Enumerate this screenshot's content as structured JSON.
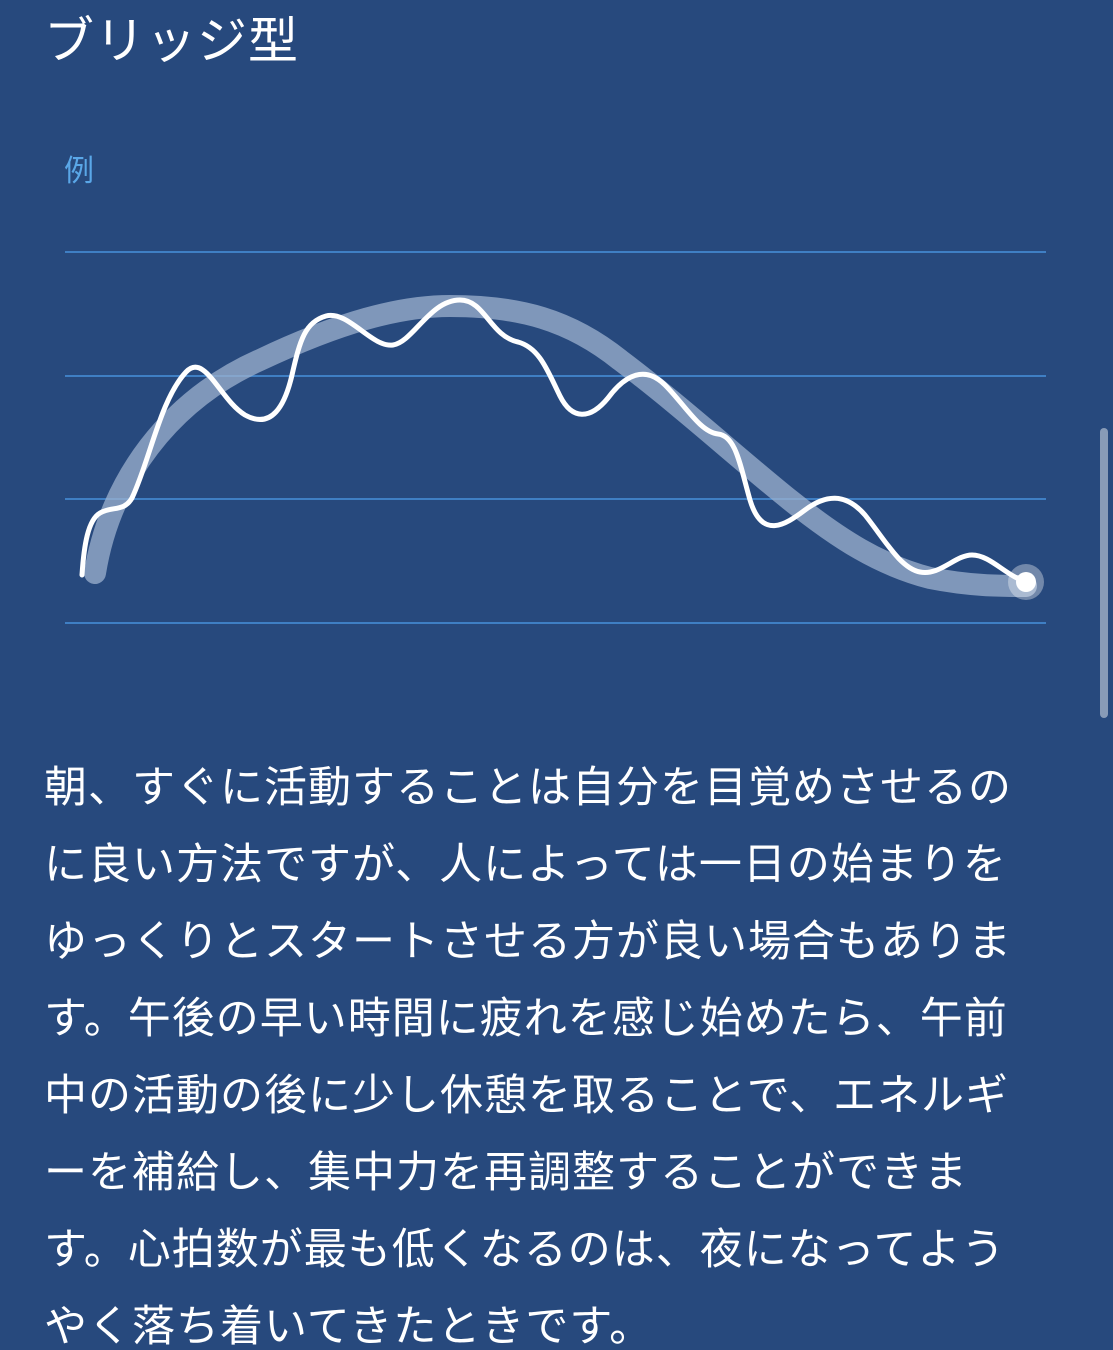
{
  "header": {
    "title": "ブリッジ型"
  },
  "chart": {
    "example_label": "例",
    "colors": {
      "background": "#27497d",
      "gridline": "#3f7fc4",
      "trend_line": "#9eb1cf",
      "detail_line": "#ffffff",
      "end_point": "#ffffff"
    }
  },
  "body": {
    "text": "朝、すぐに活動することは自分を目覚めさせるのに良い方法ですが、人によっては一日の始まりをゆっくりとスタートさせる方が良い場合もあります。午後の早い時間に疲れを感じ始めたら、午前中の活動の後に少し休憩を取ることで、エネルギーを補給し、集中力を再調整することができます。心拍数が最も低くなるのは、夜になってようやく落ち着いてきたときです。"
  }
}
